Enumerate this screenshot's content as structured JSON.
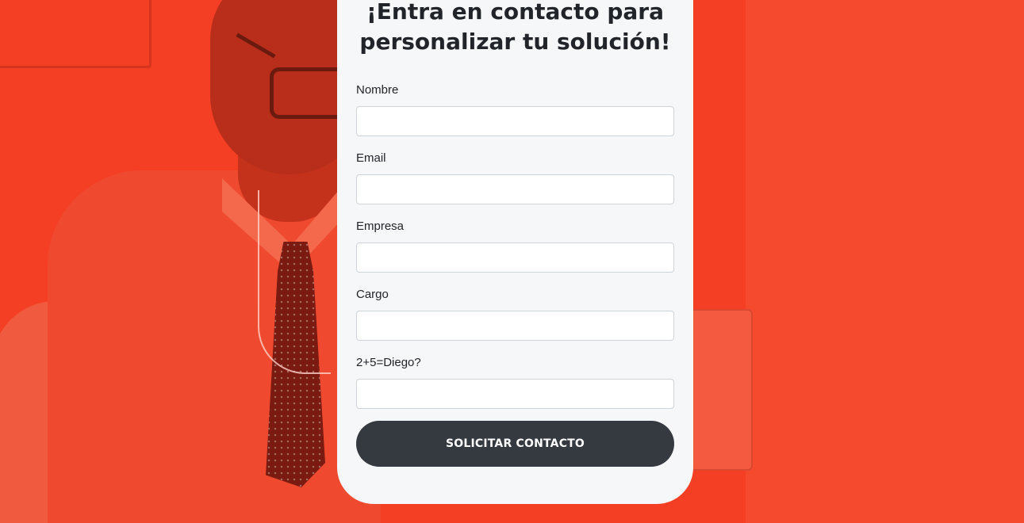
{
  "contact_form": {
    "title": "¡Entra en contacto para\npersonalizar tu solución!",
    "fields": [
      {
        "label": "Nombre",
        "value": "",
        "placeholder": ""
      },
      {
        "label": "Email",
        "value": "",
        "placeholder": ""
      },
      {
        "label": "Empresa",
        "value": "",
        "placeholder": ""
      },
      {
        "label": "Cargo",
        "value": "",
        "placeholder": ""
      },
      {
        "label": "2+5=Diego?",
        "value": "",
        "placeholder": ""
      }
    ],
    "submit_label": "SOLICITAR CONTACTO"
  },
  "colors": {
    "background_accent": "#f53f24",
    "card_background": "#f6f7f9",
    "button_background": "#343a40",
    "button_text": "#ffffff",
    "text": "#212529"
  }
}
